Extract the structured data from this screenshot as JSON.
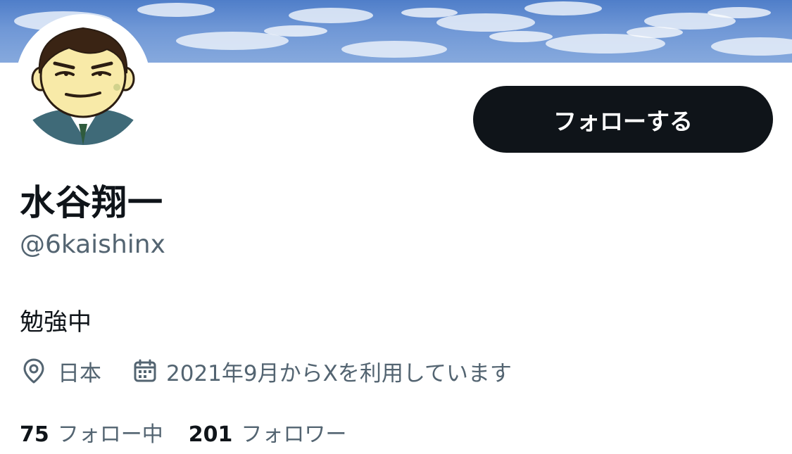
{
  "profile": {
    "display_name": "水谷翔一",
    "handle": "@6kaishinx",
    "bio": "勉強中",
    "location": "日本",
    "joined": "2021年9月からXを利用しています",
    "follow_button_label": "フォローする",
    "following_count": "75",
    "following_label": "フォロー中",
    "followers_count": "201",
    "followers_label": "フォロワー",
    "avatar_icon": "cartoon-man-avatar",
    "location_icon": "location-pin-icon",
    "calendar_icon": "calendar-icon"
  },
  "colors": {
    "text_primary": "#0f1419",
    "text_secondary": "#536471",
    "button_bg": "#0f1419",
    "button_text": "#ffffff",
    "banner_sky": "#5f8ccf"
  }
}
